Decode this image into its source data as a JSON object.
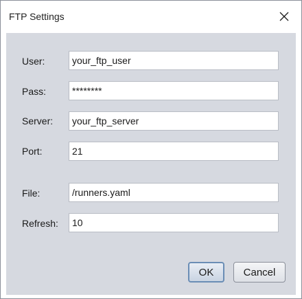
{
  "dialog": {
    "title": "FTP Settings",
    "close_icon": "close-icon"
  },
  "fields": {
    "user": {
      "label": "User:",
      "value": "your_ftp_user"
    },
    "pass": {
      "label": "Pass:",
      "value": "********"
    },
    "server": {
      "label": "Server:",
      "value": "your_ftp_server"
    },
    "port": {
      "label": "Port:",
      "value": "21"
    },
    "file": {
      "label": "File:",
      "value": "/runners.yaml"
    },
    "refresh": {
      "label": "Refresh:",
      "value": "10"
    }
  },
  "buttons": {
    "ok": "OK",
    "cancel": "Cancel"
  },
  "colors": {
    "panel_background": "#d6d9e0",
    "ok_focus_border": "#6a8db5"
  }
}
